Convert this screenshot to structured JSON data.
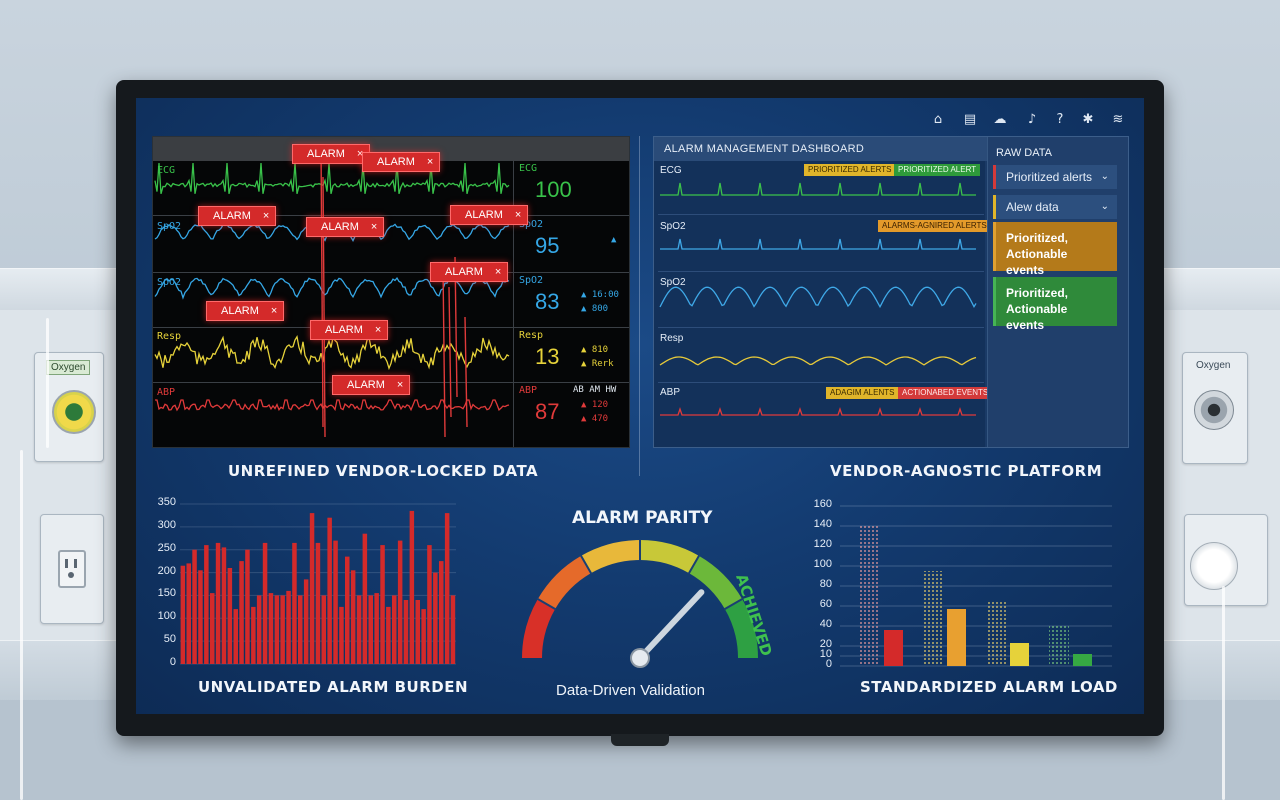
{
  "wall": {
    "left_outlet_label": "Oxygen",
    "right_outlet_label": "Oxygen"
  },
  "toolbar": {
    "icons": [
      "home-icon",
      "chat-icon",
      "cloud-upload-icon",
      "bell-icon",
      "help-icon",
      "gear-icon",
      "wifi-icon"
    ],
    "glyphs": [
      "⌂",
      "▤",
      "☁",
      "♪",
      "?",
      "✱",
      "≋"
    ]
  },
  "left_panel": {
    "caption": "UNREFINED VENDOR-LOCKED DATA",
    "channels": [
      {
        "label": "ECG",
        "color": "#39c24a"
      },
      {
        "label": "SpO2",
        "color": "#35a7e6"
      },
      {
        "label": "SpO2",
        "color": "#35a7e6"
      },
      {
        "label": "Resp",
        "color": "#e6d23a"
      },
      {
        "label": "ABP",
        "color": "#e03a3a"
      }
    ],
    "vitals": [
      {
        "label": "ECG",
        "value": "100",
        "color": "#39c24a"
      },
      {
        "label": "SpO2",
        "value": "95",
        "color": "#35a7e6",
        "extra": "▲"
      },
      {
        "label": "SpO2",
        "value": "83",
        "color": "#35a7e6",
        "extra1": "▲ 16:00",
        "extra2": "▲ 800"
      },
      {
        "label": "Resp",
        "value": "13",
        "color": "#e6d23a",
        "extra1": "▲ 810",
        "extra2": "▲ Rerk"
      },
      {
        "label": "ABP",
        "value": "87",
        "color": "#e03a3a",
        "extra1": "▲ 120",
        "extra2": "▲ 470",
        "cols": "AB   AM   HW"
      }
    ],
    "alarm_label": "ALARM",
    "alarm_close": "×"
  },
  "right_panel": {
    "caption": "VENDOR-AGNOSTIC PLATFORM",
    "header": "ALARM MANAGEMENT DASHBOARD",
    "channels": [
      {
        "label": "ECG",
        "color": "#3cc24a"
      },
      {
        "label": "SpO2",
        "color": "#3fa9e8"
      },
      {
        "label": "SpO2",
        "color": "#3fa9e8"
      },
      {
        "label": "Resp",
        "color": "#e6c93a"
      },
      {
        "label": "ABP",
        "color": "#e03a3a"
      }
    ],
    "tags": [
      {
        "text": "PRIORITIZED ALERTS",
        "bg": "#e0b52a",
        "fg": "#3a2a00"
      },
      {
        "text": "PRIORITIZED ALERT",
        "bg": "#2e9a3a",
        "fg": "#eafbe9"
      },
      {
        "text": "ALARMS-AGNIRED ALERTS",
        "bg": "#e39a2a",
        "fg": "#3a2000"
      },
      {
        "text": "ADAGIM ALENTS",
        "bg": "#e0b52a",
        "fg": "#3a2a00"
      },
      {
        "text": "ACTIONABED EVENTS",
        "bg": "#d33a3a",
        "fg": "#ffecec"
      }
    ],
    "side": {
      "title": "RAW DATA",
      "items": [
        {
          "label": "Prioritized alerts",
          "accent": "#d33a3a"
        },
        {
          "label": "Alew data",
          "accent": "#e0b52a"
        }
      ],
      "cards": [
        {
          "line1": "Prioritized,",
          "line2": "Actionable events",
          "bg": "#b47a1a",
          "border": "#e0a030"
        },
        {
          "line1": "Prioritized,",
          "line2": "Actionable events",
          "bg": "#2f8a3a",
          "border": "#46b455"
        }
      ]
    }
  },
  "gauge": {
    "title": "ALARM PARITY",
    "subtitle": "Data-Driven Validation",
    "status": "ACHIEVED",
    "value_fraction": 0.85
  },
  "chart_data": [
    {
      "type": "bar",
      "title": "UNVALIDATED ALARM BURDEN",
      "ylim": [
        0,
        350
      ],
      "yticks": [
        0,
        50,
        100,
        150,
        200,
        250,
        300,
        350
      ],
      "color": "#d42a2a",
      "values": [
        215,
        220,
        250,
        205,
        260,
        155,
        265,
        255,
        210,
        120,
        225,
        250,
        125,
        150,
        265,
        155,
        150,
        150,
        160,
        265,
        150,
        185,
        330,
        265,
        150,
        320,
        270,
        125,
        235,
        205,
        150,
        285,
        150,
        155,
        260,
        125,
        150,
        270,
        140,
        335,
        140,
        120,
        260,
        200,
        225,
        330,
        150
      ]
    },
    {
      "type": "bar",
      "title": "STANDARDIZED ALARM LOAD",
      "ylim": [
        0,
        160
      ],
      "yticks": [
        0,
        10,
        20,
        40,
        60,
        80,
        100,
        120,
        140,
        160
      ],
      "categories": [
        "1",
        "2",
        "3",
        "4"
      ],
      "series": [
        {
          "values": [
            140,
            95,
            65,
            40
          ],
          "color": "#e58585"
        },
        {
          "values": [
            36,
            57,
            23,
            12
          ],
          "colors": [
            "#d42a2a",
            "#e8a030",
            "#e6d23a",
            "#36a843"
          ]
        }
      ]
    }
  ]
}
